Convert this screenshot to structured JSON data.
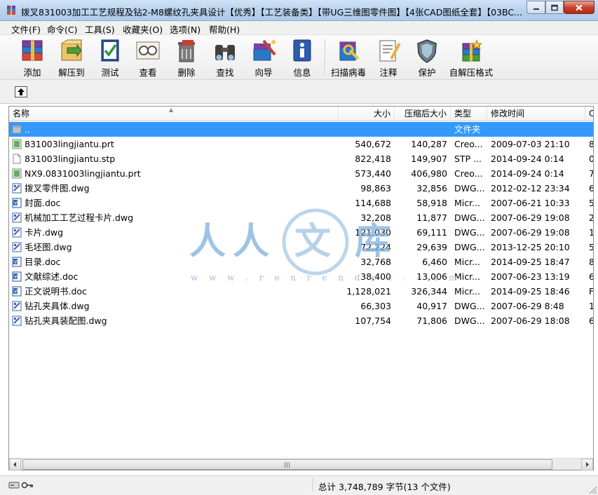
{
  "window": {
    "title": "拨叉831003加工工艺规程及钻2-M8螺纹孔夹具设计【优秀】【工艺装备类】【带UG三维图零件图】【4张CAD图纸全套】【03BC..."
  },
  "menu": [
    "文件(F)",
    "命令(C)",
    "工具(S)",
    "收藏夹(O)",
    "选项(N)",
    "帮助(H)"
  ],
  "toolbar": [
    {
      "label": "添加",
      "icon": "add-archive-icon"
    },
    {
      "label": "解压到",
      "icon": "extract-to-icon"
    },
    {
      "label": "测试",
      "icon": "test-icon"
    },
    {
      "label": "查看",
      "icon": "view-icon"
    },
    {
      "label": "删除",
      "icon": "delete-icon"
    },
    {
      "label": "查找",
      "icon": "find-icon"
    },
    {
      "label": "向导",
      "icon": "wizard-icon"
    },
    {
      "label": "信息",
      "icon": "info-icon"
    },
    {
      "label": "扫描病毒",
      "icon": "virus-scan-icon"
    },
    {
      "label": "注释",
      "icon": "comment-icon"
    },
    {
      "label": "保护",
      "icon": "protect-icon"
    },
    {
      "label": "自解压格式",
      "icon": "sfx-icon"
    }
  ],
  "columns": {
    "name": "名称",
    "size": "大小",
    "packed": "压缩后大小",
    "type": "类型",
    "modified": "修改时间",
    "crc": "C"
  },
  "files": [
    {
      "name": "..",
      "size": "",
      "packed": "",
      "type": "文件夹",
      "modified": "",
      "crc": "",
      "icon": "folder-up-icon",
      "selected": true
    },
    {
      "name": "831003lingjiantu.prt",
      "size": "540,672",
      "packed": "140,287",
      "type": "Creo...",
      "modified": "2009-07-03 21:10",
      "crc": "8",
      "icon": "prt-file-icon"
    },
    {
      "name": "831003lingjiantu.stp",
      "size": "822,418",
      "packed": "149,907",
      "type": "STP ...",
      "modified": "2014-09-24 0:14",
      "crc": "0",
      "icon": "blank-file-icon"
    },
    {
      "name": "NX9.0831003lingjiantu.prt",
      "size": "573,440",
      "packed": "406,980",
      "type": "Creo...",
      "modified": "2014-09-24 0:14",
      "crc": "7",
      "icon": "prt-file-icon"
    },
    {
      "name": "拨叉零件图.dwg",
      "size": "98,863",
      "packed": "32,856",
      "type": "DWG...",
      "modified": "2012-02-12 23:34",
      "crc": "6",
      "icon": "dwg-file-icon"
    },
    {
      "name": "封面.doc",
      "size": "114,688",
      "packed": "58,918",
      "type": "Micr...",
      "modified": "2007-06-21 10:33",
      "crc": "5",
      "icon": "doc-file-icon"
    },
    {
      "name": "机械加工工艺过程卡片.dwg",
      "size": "32,208",
      "packed": "11,877",
      "type": "DWG...",
      "modified": "2007-06-29 19:08",
      "crc": "2",
      "icon": "dwg-file-icon"
    },
    {
      "name": "卡片.dwg",
      "size": "121,030",
      "packed": "69,111",
      "type": "DWG...",
      "modified": "2007-06-29 19:08",
      "crc": "1",
      "icon": "dwg-file-icon"
    },
    {
      "name": "毛坯图.dwg",
      "size": "72,224",
      "packed": "29,639",
      "type": "DWG...",
      "modified": "2013-12-25 20:10",
      "crc": "5",
      "icon": "dwg-file-icon"
    },
    {
      "name": "目录.doc",
      "size": "32,768",
      "packed": "6,460",
      "type": "Micr...",
      "modified": "2014-09-25 18:47",
      "crc": "8",
      "icon": "doc-file-icon"
    },
    {
      "name": "文献综述.doc",
      "size": "38,400",
      "packed": "13,006",
      "type": "Micr...",
      "modified": "2007-06-23 13:19",
      "crc": "6",
      "icon": "doc-file-icon"
    },
    {
      "name": "正文说明书.doc",
      "size": "1,128,021",
      "packed": "326,344",
      "type": "Micr...",
      "modified": "2014-09-25 18:46",
      "crc": "F",
      "icon": "doc-file-icon"
    },
    {
      "name": "钻孔夹具体.dwg",
      "size": "66,303",
      "packed": "40,917",
      "type": "DWG...",
      "modified": "2007-06-29 8:48",
      "crc": "1",
      "icon": "dwg-file-icon"
    },
    {
      "name": "钻孔夹具装配图.dwg",
      "size": "107,754",
      "packed": "71,806",
      "type": "DWG...",
      "modified": "2007-06-29 18:08",
      "crc": "6",
      "icon": "dwg-file-icon"
    }
  ],
  "watermark": {
    "chars": [
      "人",
      "人",
      "文",
      "库"
    ],
    "url": "w w w . r e n r e n d o c . c o m"
  },
  "status": {
    "summary": "总计 3,748,789 字节(13 个文件)"
  },
  "colors": {
    "selection": "#3399ff",
    "titlebar": "#b9d3ee",
    "watermark": "#8fb3d6"
  }
}
